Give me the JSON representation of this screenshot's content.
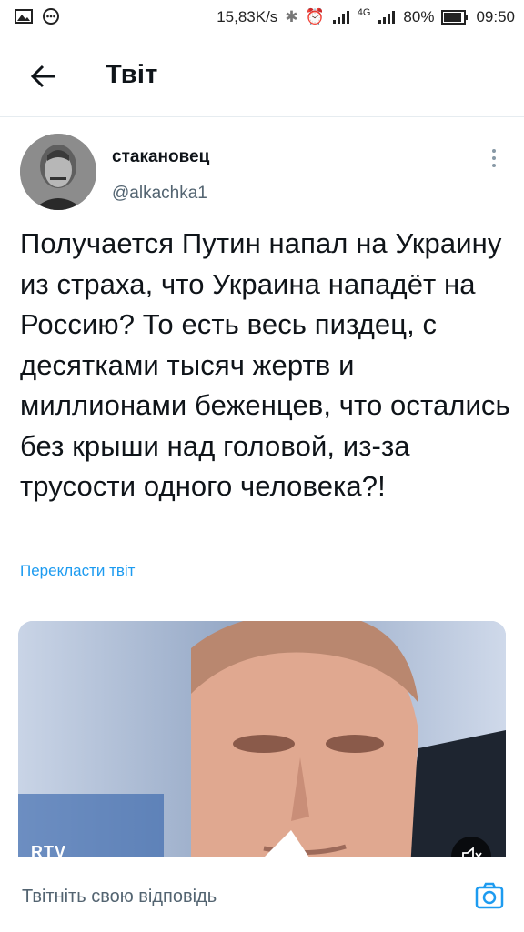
{
  "status_bar": {
    "speed": "15,83K/s",
    "network": "4G",
    "battery": "80%",
    "time": "09:50"
  },
  "header": {
    "title": "Твіт",
    "back_icon": "arrow-left-icon"
  },
  "tweet": {
    "author_name": "стакановец",
    "author_handle": "@alkachka1",
    "text": "Получается Путин напал на Украину из страха, что Украина нападёт на Россию? То есть весь пиздец, с десятками тысяч жертв и миллионами беженцев, что остались без крыши над головой, из-за трусости одного человека?!",
    "translate_label": "Перекласти твіт",
    "media_watermark": "RTV"
  },
  "reply": {
    "placeholder": "Твітніть свою відповідь",
    "camera_icon": "camera-icon"
  },
  "colors": {
    "accent": "#1d9bf0",
    "text": "#0f1419",
    "secondary": "#536471"
  }
}
